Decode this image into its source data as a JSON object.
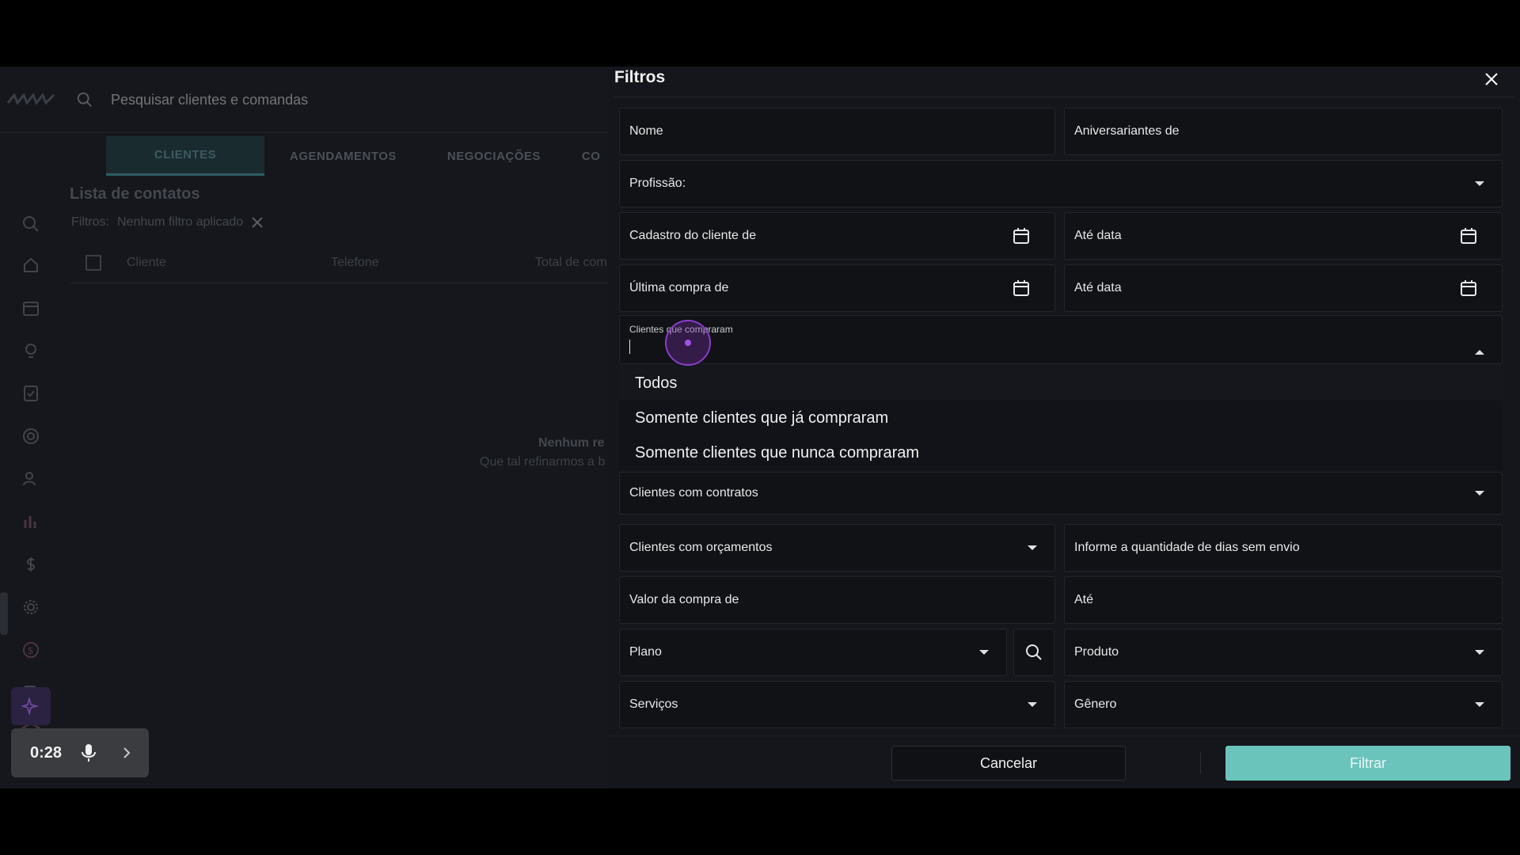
{
  "topbar": {
    "search_placeholder": "Pesquisar clientes e comandas"
  },
  "tabs": [
    "CLIENTES",
    "AGENDAMENTOS",
    "NEGOCIAÇÕES",
    "CO"
  ],
  "list": {
    "title": "Lista de contatos",
    "filters_label": "Filtros:",
    "filters_value": "Nenhum filtro aplicado",
    "columns": [
      "Cliente",
      "Telefone",
      "Total de com"
    ],
    "empty_title": "Nenhum re",
    "empty_subtitle": "Que tal refinarmos a b"
  },
  "recorder": {
    "time": "0:28"
  },
  "modal": {
    "title": "Filtros",
    "fields": {
      "nome": "Nome",
      "aniversariantes": "Aniversariantes de",
      "profissao": "Profissão:",
      "cadastro_de": "Cadastro do cliente de",
      "cadastro_ate": "Até data",
      "ultima_compra_de": "Última compra de",
      "ultima_compra_ate": "Até data",
      "clientes_compraram_label": "Clientes que compraram",
      "clientes_contratos": "Clientes com contratos",
      "clientes_orcamentos": "Clientes com orçamentos",
      "dias_sem_envio": "Informe a quantidade de dias sem envio",
      "valor_compra_de": "Valor da compra de",
      "valor_ate": "Até",
      "plano": "Plano",
      "produto": "Produto",
      "servicos": "Serviços",
      "genero": "Gênero"
    },
    "dropdown_options": [
      "Todos",
      "Somente clientes que já compraram",
      "Somente clientes que nunca compraram"
    ],
    "cancel_label": "Cancelar",
    "filter_label": "Filtrar"
  },
  "colors": {
    "accent": "#6bc4bc",
    "click_ring": "#8a3cc8"
  }
}
